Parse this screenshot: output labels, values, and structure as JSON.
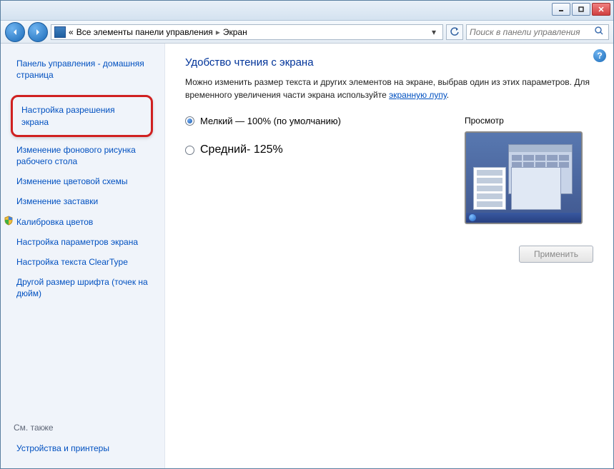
{
  "breadcrumb": {
    "prefix": "«",
    "parent": "Все элементы панели управления",
    "current": "Экран"
  },
  "search": {
    "placeholder": "Поиск в панели управления"
  },
  "sidebar": {
    "home": "Панель управления - домашняя страница",
    "items": [
      "Настройка разрешения экрана",
      "Изменение фонового рисунка рабочего стола",
      "Изменение цветовой схемы",
      "Изменение заставки",
      "Калибровка цветов",
      "Настройка параметров экрана",
      "Настройка текста ClearType",
      "Другой размер шрифта (точек на дюйм)"
    ],
    "see_also_label": "См. также",
    "see_also_item": "Устройства и принтеры"
  },
  "main": {
    "title": "Удобство чтения с экрана",
    "desc_part1": "Можно изменить размер текста и других элементов на экране, выбрав один из этих параметров. Для временного увеличения части экрана используйте ",
    "desc_link": "экранную лупу",
    "desc_part2": ".",
    "option_small": "Мелкий — 100% (по умолчанию)",
    "option_medium": "Средний- 125%",
    "preview_label": "Просмотр",
    "apply_label": "Применить"
  }
}
